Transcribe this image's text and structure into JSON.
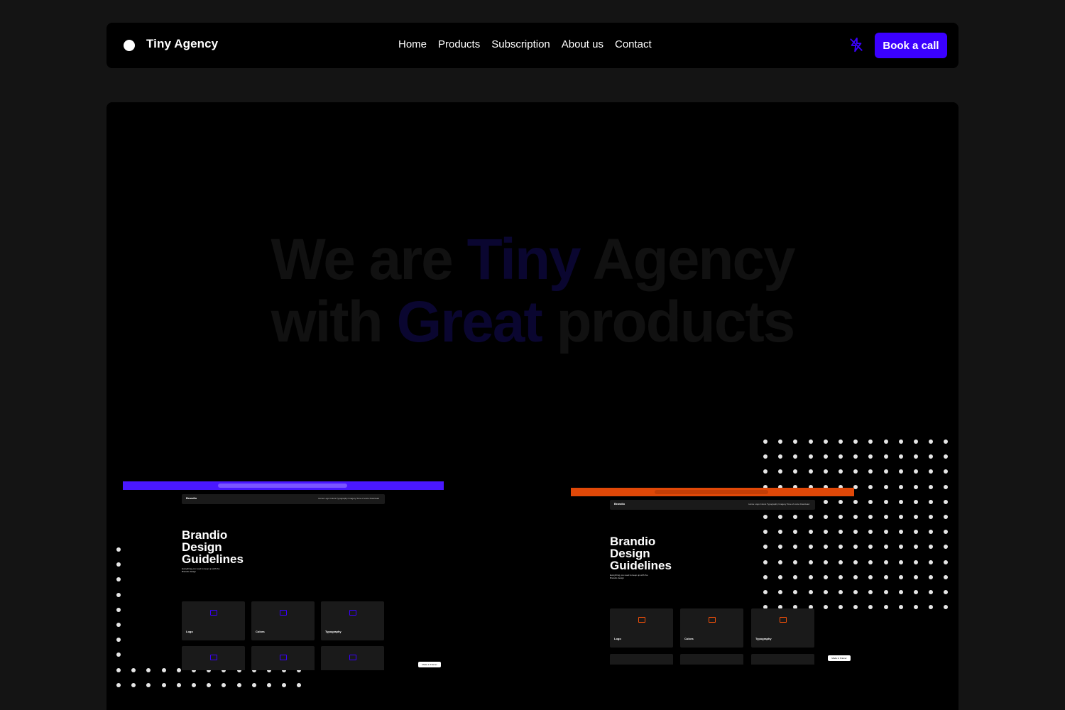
{
  "header": {
    "brand": "Tiny Agency",
    "menu": [
      "Home",
      "Products",
      "Subscription",
      "About us",
      "Contact"
    ],
    "cta_label": "Book a call",
    "icons": {
      "logo": "circle-logo-icon",
      "toggle": "bolt-off-icon"
    },
    "accent_color": "#3b00ff"
  },
  "hero": {
    "line1_a": "We are",
    "line1_accent": "Tiny",
    "line1_b": "Agency",
    "line2_a": "with",
    "line2_accent": "Great",
    "line2_b": "products"
  },
  "mockups": [
    {
      "color": "#3b00ff",
      "brand": "Brandio",
      "nav_links": "Home  Logo  Colors  Typography  Imagery  Tone of voice  Download",
      "title_lines": [
        "Brandio",
        "Design",
        "Guidelines"
      ],
      "subtitle": "Everything you need to keep up with the Brandio design",
      "cards": [
        "Logo",
        "Colors",
        "Typography"
      ],
      "badge": "Made in Framer"
    },
    {
      "color": "#f25009",
      "brand": "Brandio",
      "nav_links": "Home  Logo  Colors  Typography  Imagery  Tone of voice  Download",
      "title_lines": [
        "Brandio",
        "Design",
        "Guidelines"
      ],
      "subtitle": "Everything you need to keep up with the Brandio design",
      "cards": [
        "Logo",
        "Colors",
        "Typography"
      ],
      "badge": "Made in Framer"
    }
  ]
}
